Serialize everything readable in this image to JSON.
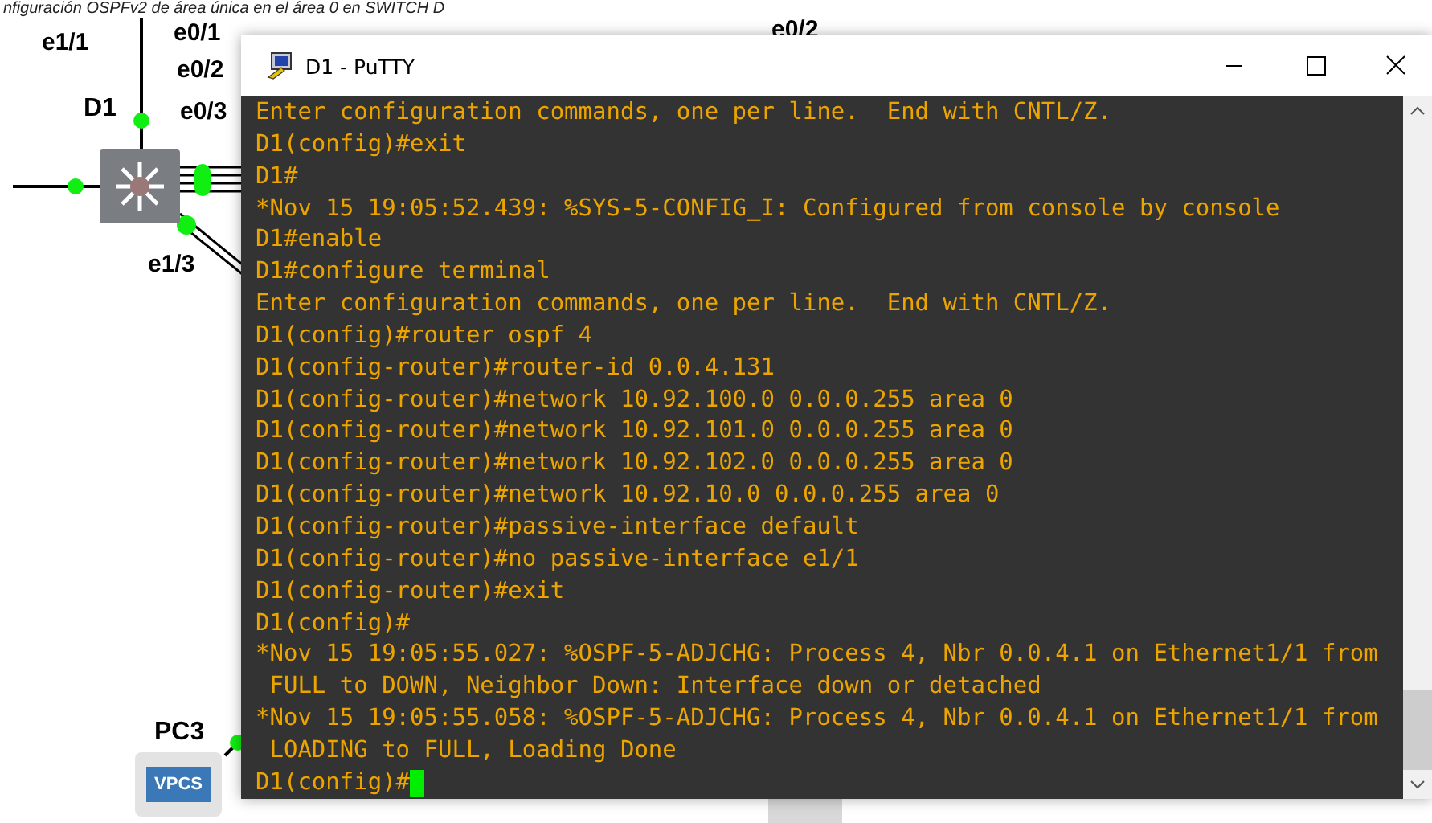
{
  "caption": "nfiguración OSPFv2 de área única en el área 0 en SWITCH D",
  "diagram": {
    "labels": [
      {
        "text": "e1/1",
        "kind": "port"
      },
      {
        "text": "e0/1",
        "kind": "port"
      },
      {
        "text": "e0/2",
        "kind": "port"
      },
      {
        "text": "D1",
        "kind": "device"
      },
      {
        "text": "e0/3",
        "kind": "port"
      },
      {
        "text": "e1/3",
        "kind": "port"
      },
      {
        "text": "e0/2",
        "kind": "port"
      },
      {
        "text": "PC3",
        "kind": "device"
      }
    ],
    "vpcs_label": "VPCS"
  },
  "window": {
    "title": "D1 - PuTTY"
  },
  "terminal": {
    "lines": [
      "Enter configuration commands, one per line.  End with CNTL/Z.",
      "D1(config)#exit",
      "D1#",
      "*Nov 15 19:05:52.439: %SYS-5-CONFIG_I: Configured from console by console",
      "D1#enable",
      "D1#configure terminal",
      "Enter configuration commands, one per line.  End with CNTL/Z.",
      "D1(config)#router ospf 4",
      "D1(config-router)#router-id 0.0.4.131",
      "D1(config-router)#network 10.92.100.0 0.0.0.255 area 0",
      "D1(config-router)#network 10.92.101.0 0.0.0.255 area 0",
      "D1(config-router)#network 10.92.102.0 0.0.0.255 area 0",
      "D1(config-router)#network 10.92.10.0 0.0.0.255 area 0",
      "D1(config-router)#passive-interface default",
      "D1(config-router)#no passive-interface e1/1",
      "D1(config-router)#exit",
      "D1(config)#",
      "*Nov 15 19:05:55.027: %OSPF-5-ADJCHG: Process 4, Nbr 0.0.4.1 on Ethernet1/1 from",
      " FULL to DOWN, Neighbor Down: Interface down or detached",
      "*Nov 15 19:05:55.058: %OSPF-5-ADJCHG: Process 4, Nbr 0.0.4.1 on Ethernet1/1 from",
      " LOADING to FULL, Loading Done"
    ],
    "prompt": "D1(config)#"
  }
}
